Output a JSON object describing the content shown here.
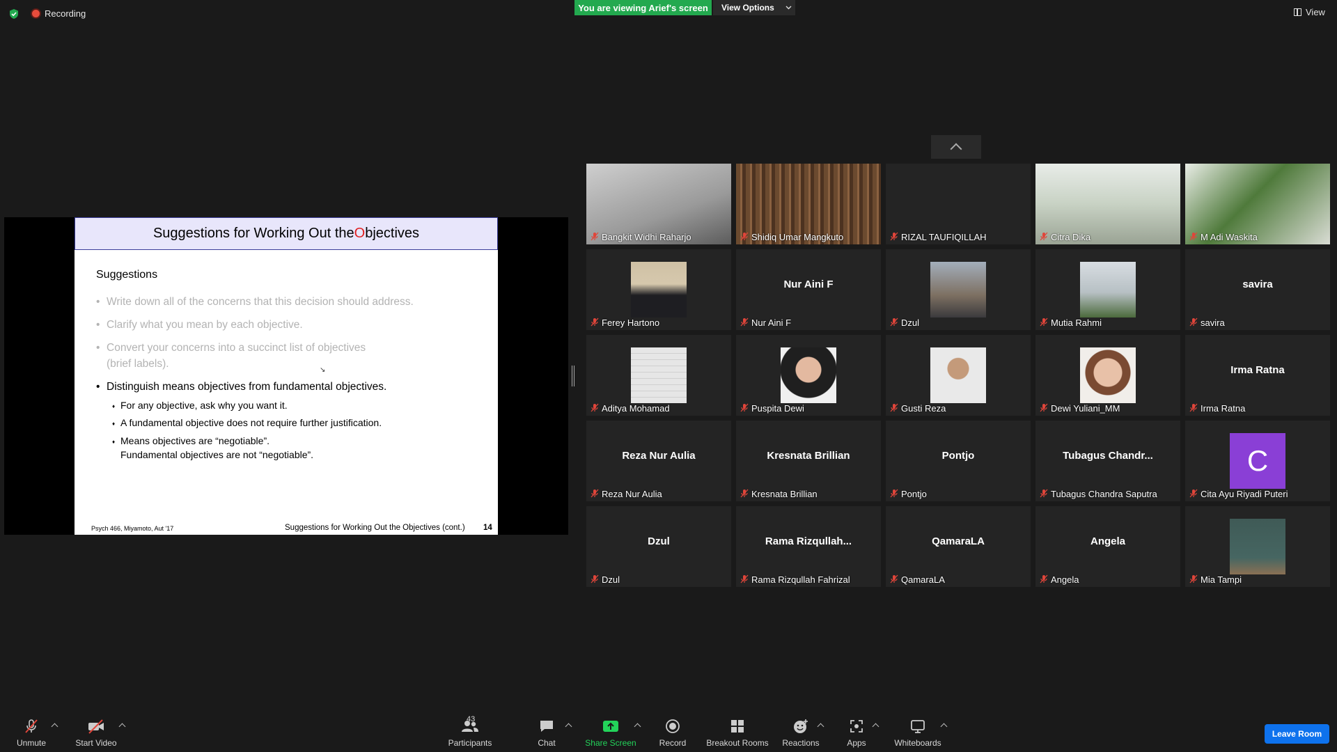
{
  "top": {
    "recording_label": "Recording",
    "viewing_banner": "You are viewing Arief's screen",
    "view_options_label": "View Options",
    "view_label": "View"
  },
  "slide": {
    "title_pre": "Suggestions for Working Out the ",
    "title_o": "O",
    "title_post": "bjectives",
    "heading": "Suggestions",
    "bullets_gray": [
      "Write down all of the concerns that this decision should address.",
      "Clarify what you mean by each objective.",
      "Convert your concerns into a succinct list of objectives",
      "(brief labels)."
    ],
    "bullet_main": "Distinguish means objectives from fundamental objectives.",
    "sub_bullets": [
      "For any objective, ask why you want it.",
      "A fundamental objective does not require further justification.",
      "Means objectives are “negotiable”.",
      "Fundamental objectives are not “negotiable”."
    ],
    "footer_left": "Psych 466, Miyamoto, Aut '17",
    "footer_right": "Suggestions for Working Out the Objectives (cont.)",
    "page_number": "14"
  },
  "participants": [
    {
      "name": "Bangkit Widhi Raharjo",
      "display": ""
    },
    {
      "name": "Shidiq Umar Mangkuto",
      "display": ""
    },
    {
      "name": "RIZAL TAUFIQILLAH",
      "display": ""
    },
    {
      "name": "Citra Dika",
      "display": ""
    },
    {
      "name": "M Adi Waskita",
      "display": ""
    },
    {
      "name": "Ferey Hartono",
      "display": ""
    },
    {
      "name": "Nur Aini F",
      "display": "Nur Aini F"
    },
    {
      "name": "Dzul",
      "display": ""
    },
    {
      "name": "Mutia Rahmi",
      "display": ""
    },
    {
      "name": "savira",
      "display": "savira"
    },
    {
      "name": "Aditya Mohamad",
      "display": ""
    },
    {
      "name": "Puspita Dewi",
      "display": ""
    },
    {
      "name": "Gusti Reza",
      "display": ""
    },
    {
      "name": "Dewi Yuliani_MM",
      "display": ""
    },
    {
      "name": "Irma Ratna",
      "display": "Irma Ratna"
    },
    {
      "name": "Reza Nur Aulia",
      "display": "Reza Nur Aulia"
    },
    {
      "name": "Kresnata Brillian",
      "display": "Kresnata Brillian"
    },
    {
      "name": "Pontjo",
      "display": "Pontjo"
    },
    {
      "name": "Tubagus Chandra Saputra",
      "display": "Tubagus  Chandr..."
    },
    {
      "name": "Cita Ayu Riyadi Puteri",
      "display": "",
      "letter": "C"
    },
    {
      "name": "Dzul",
      "display": "Dzul"
    },
    {
      "name": "Rama Rizqullah Fahrizal",
      "display": "Rama  Rizqullah..."
    },
    {
      "name": "QamaraLA",
      "display": "QamaraLA"
    },
    {
      "name": "Angela",
      "display": "Angela"
    },
    {
      "name": "Mia Tampi",
      "display": ""
    }
  ],
  "toolbar": {
    "unmute": "Unmute",
    "start_video": "Start Video",
    "participants": "Participants",
    "participants_count": "43",
    "chat": "Chat",
    "share_screen": "Share Screen",
    "record": "Record",
    "breakout_rooms": "Breakout Rooms",
    "reactions": "Reactions",
    "apps": "Apps",
    "whiteboards": "Whiteboards",
    "leave_room": "Leave Room"
  },
  "colors": {
    "banner_green": "#23a94f",
    "share_green": "#23d35a",
    "leave_blue": "#0e72ed",
    "mic_off_red": "#e0453a",
    "avatar_purple": "#8a3fd6"
  }
}
